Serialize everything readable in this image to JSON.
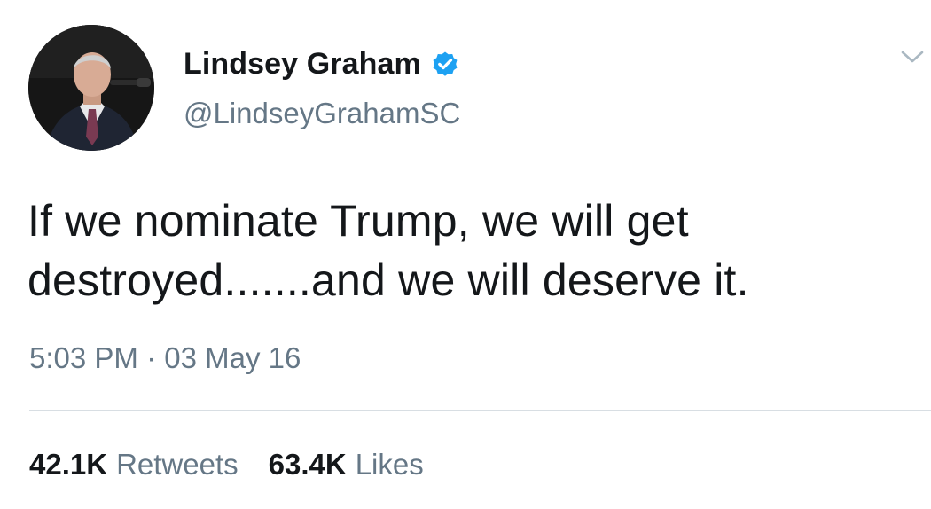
{
  "author": {
    "display_name": "Lindsey Graham",
    "handle": "@LindseyGrahamSC",
    "verified": true,
    "avatar_icon": "profile-photo"
  },
  "tweet": {
    "text_lines": [
      "If we nominate Trump, we will get",
      "destroyed.......and we will deserve it."
    ],
    "timestamp": "5:03 PM · 03 May 16"
  },
  "stats": {
    "retweets": {
      "count": "42.1K",
      "label": "Retweets"
    },
    "likes": {
      "count": "63.4K",
      "label": "Likes"
    }
  },
  "colors": {
    "text": "#14171a",
    "secondary": "#657786",
    "verified_badge": "#1da1f2",
    "divider": "#d8dee3",
    "chevron": "#aab8c2"
  },
  "icons": {
    "verified": "verified-badge-icon",
    "menu": "chevron-down-icon"
  }
}
